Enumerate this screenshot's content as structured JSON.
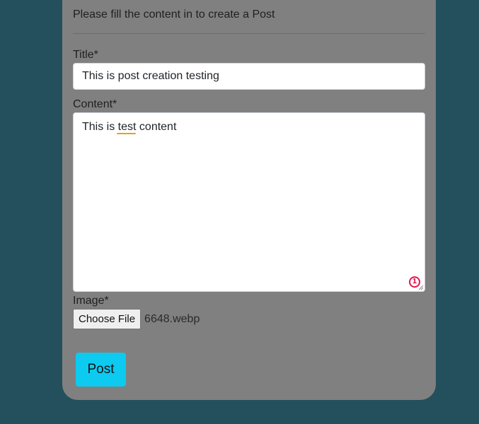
{
  "form": {
    "intro_text": "Please fill the content in to create a Post",
    "title_label": "Title*",
    "title_value": "This is post creation testing",
    "content_label": "Content*",
    "content_value_before": "This is ",
    "content_value_misspelled": "test",
    "content_value_after": " content",
    "content_badge": "1",
    "image_label": "Image*",
    "choose_file_label": "Choose File",
    "file_name": "6648.webp",
    "post_button_label": "Post"
  },
  "colors": {
    "page_background": "#24505d",
    "card_background": "#808080",
    "post_button": "#0dcaf0",
    "spell_underline": "#e6a117",
    "badge": "#e0184f"
  },
  "icons": {
    "badge": "numbered-circle-icon",
    "resize": "resize-handle-icon"
  }
}
